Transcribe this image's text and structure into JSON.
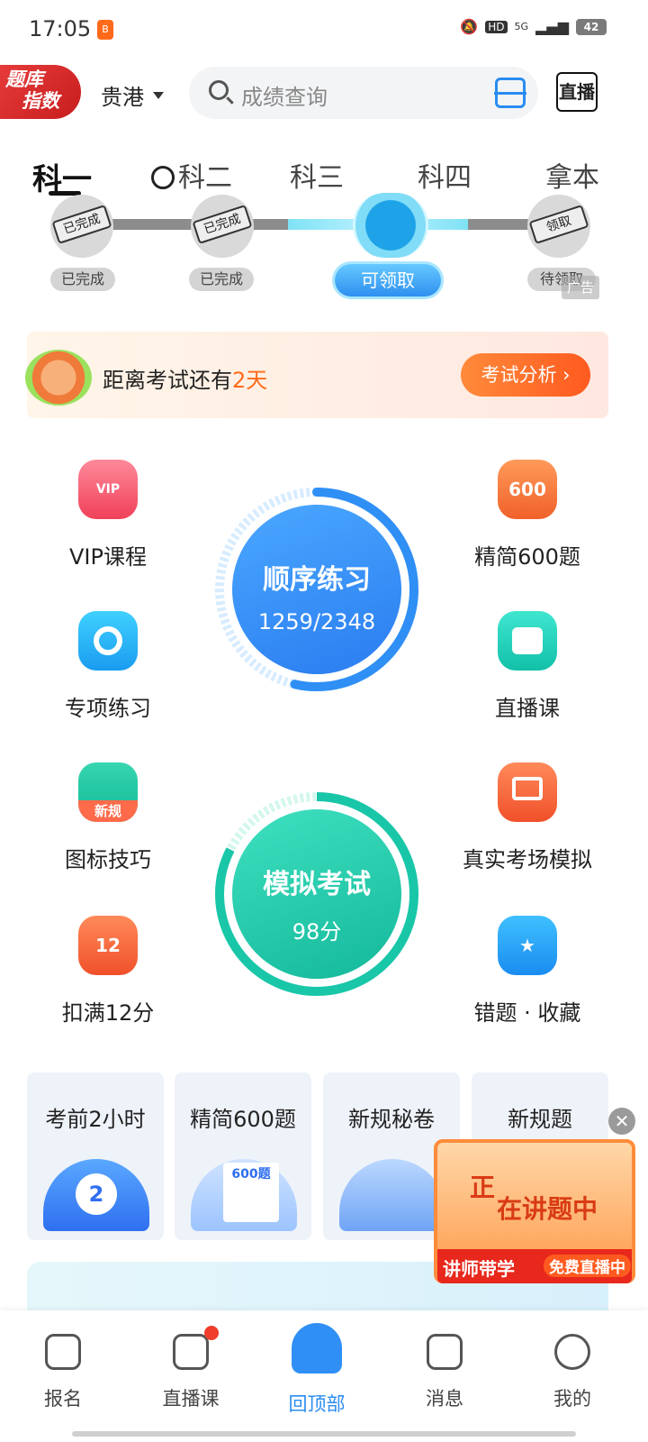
{
  "status_bar": {
    "time": "17:05",
    "network": "5G",
    "battery": "42"
  },
  "header": {
    "logo_line1": "题库",
    "logo_line2": "指数",
    "city": "贵港",
    "search_placeholder": "成绩查询",
    "live_label": "直播"
  },
  "tabs": [
    {
      "label": "科一",
      "active": true
    },
    {
      "label": "科二",
      "active": false
    },
    {
      "label": "科三",
      "active": false
    },
    {
      "label": "科四",
      "active": false
    },
    {
      "label": "拿本",
      "active": false
    }
  ],
  "progress": {
    "node1_stamp": "已完成",
    "node1_label": "已完成",
    "node2_stamp": "已完成",
    "node2_label": "已完成",
    "node3_label": "可领取",
    "node4_stamp": "领取",
    "node4_label": "待领取",
    "ad_tag": "广告"
  },
  "countdown": {
    "prefix": "距离考试还有",
    "days": "2天",
    "button": "考试分析 ›"
  },
  "features_left": [
    {
      "label": "VIP课程",
      "icon": "vip-icon",
      "text": "VIP"
    },
    {
      "label": "专项练习",
      "icon": "target-icon",
      "text": ""
    },
    {
      "label": "图标技巧",
      "icon": "sign-icon",
      "text": "新规"
    },
    {
      "label": "扣满12分",
      "icon": "calendar-12-icon",
      "text": "12"
    }
  ],
  "features_right": [
    {
      "label": "精简600题",
      "icon": "600-icon",
      "text": "600"
    },
    {
      "label": "直播课",
      "icon": "video-icon",
      "text": ""
    },
    {
      "label": "真实考场模拟",
      "icon": "monitor-icon",
      "text": ""
    },
    {
      "label": "错题 · 收藏",
      "icon": "bookmark-star-icon",
      "text": "★"
    }
  ],
  "practice_circle": {
    "title": "顺序练习",
    "progress": "1259/2348",
    "done": 1259,
    "total": 2348
  },
  "exam_circle": {
    "title": "模拟考试",
    "score": "98分"
  },
  "cards": [
    {
      "title": "考前2小时"
    },
    {
      "title": "精简600题"
    },
    {
      "title": "新规秘卷"
    },
    {
      "title": "新规题"
    }
  ],
  "floating_ad": {
    "line1": "正",
    "line2": "在讲题中",
    "footer_left": "讲师带学",
    "footer_right": "免费直播中"
  },
  "bottom_nav": [
    {
      "label": "报名",
      "active": false
    },
    {
      "label": "直播课",
      "active": false
    },
    {
      "label": "回顶部",
      "active": true
    },
    {
      "label": "消息",
      "active": false
    },
    {
      "label": "我的",
      "active": false
    }
  ],
  "colors": {
    "accent": "#2a8cf0",
    "orange": "#ff6a1a",
    "teal": "#19c6a8"
  }
}
